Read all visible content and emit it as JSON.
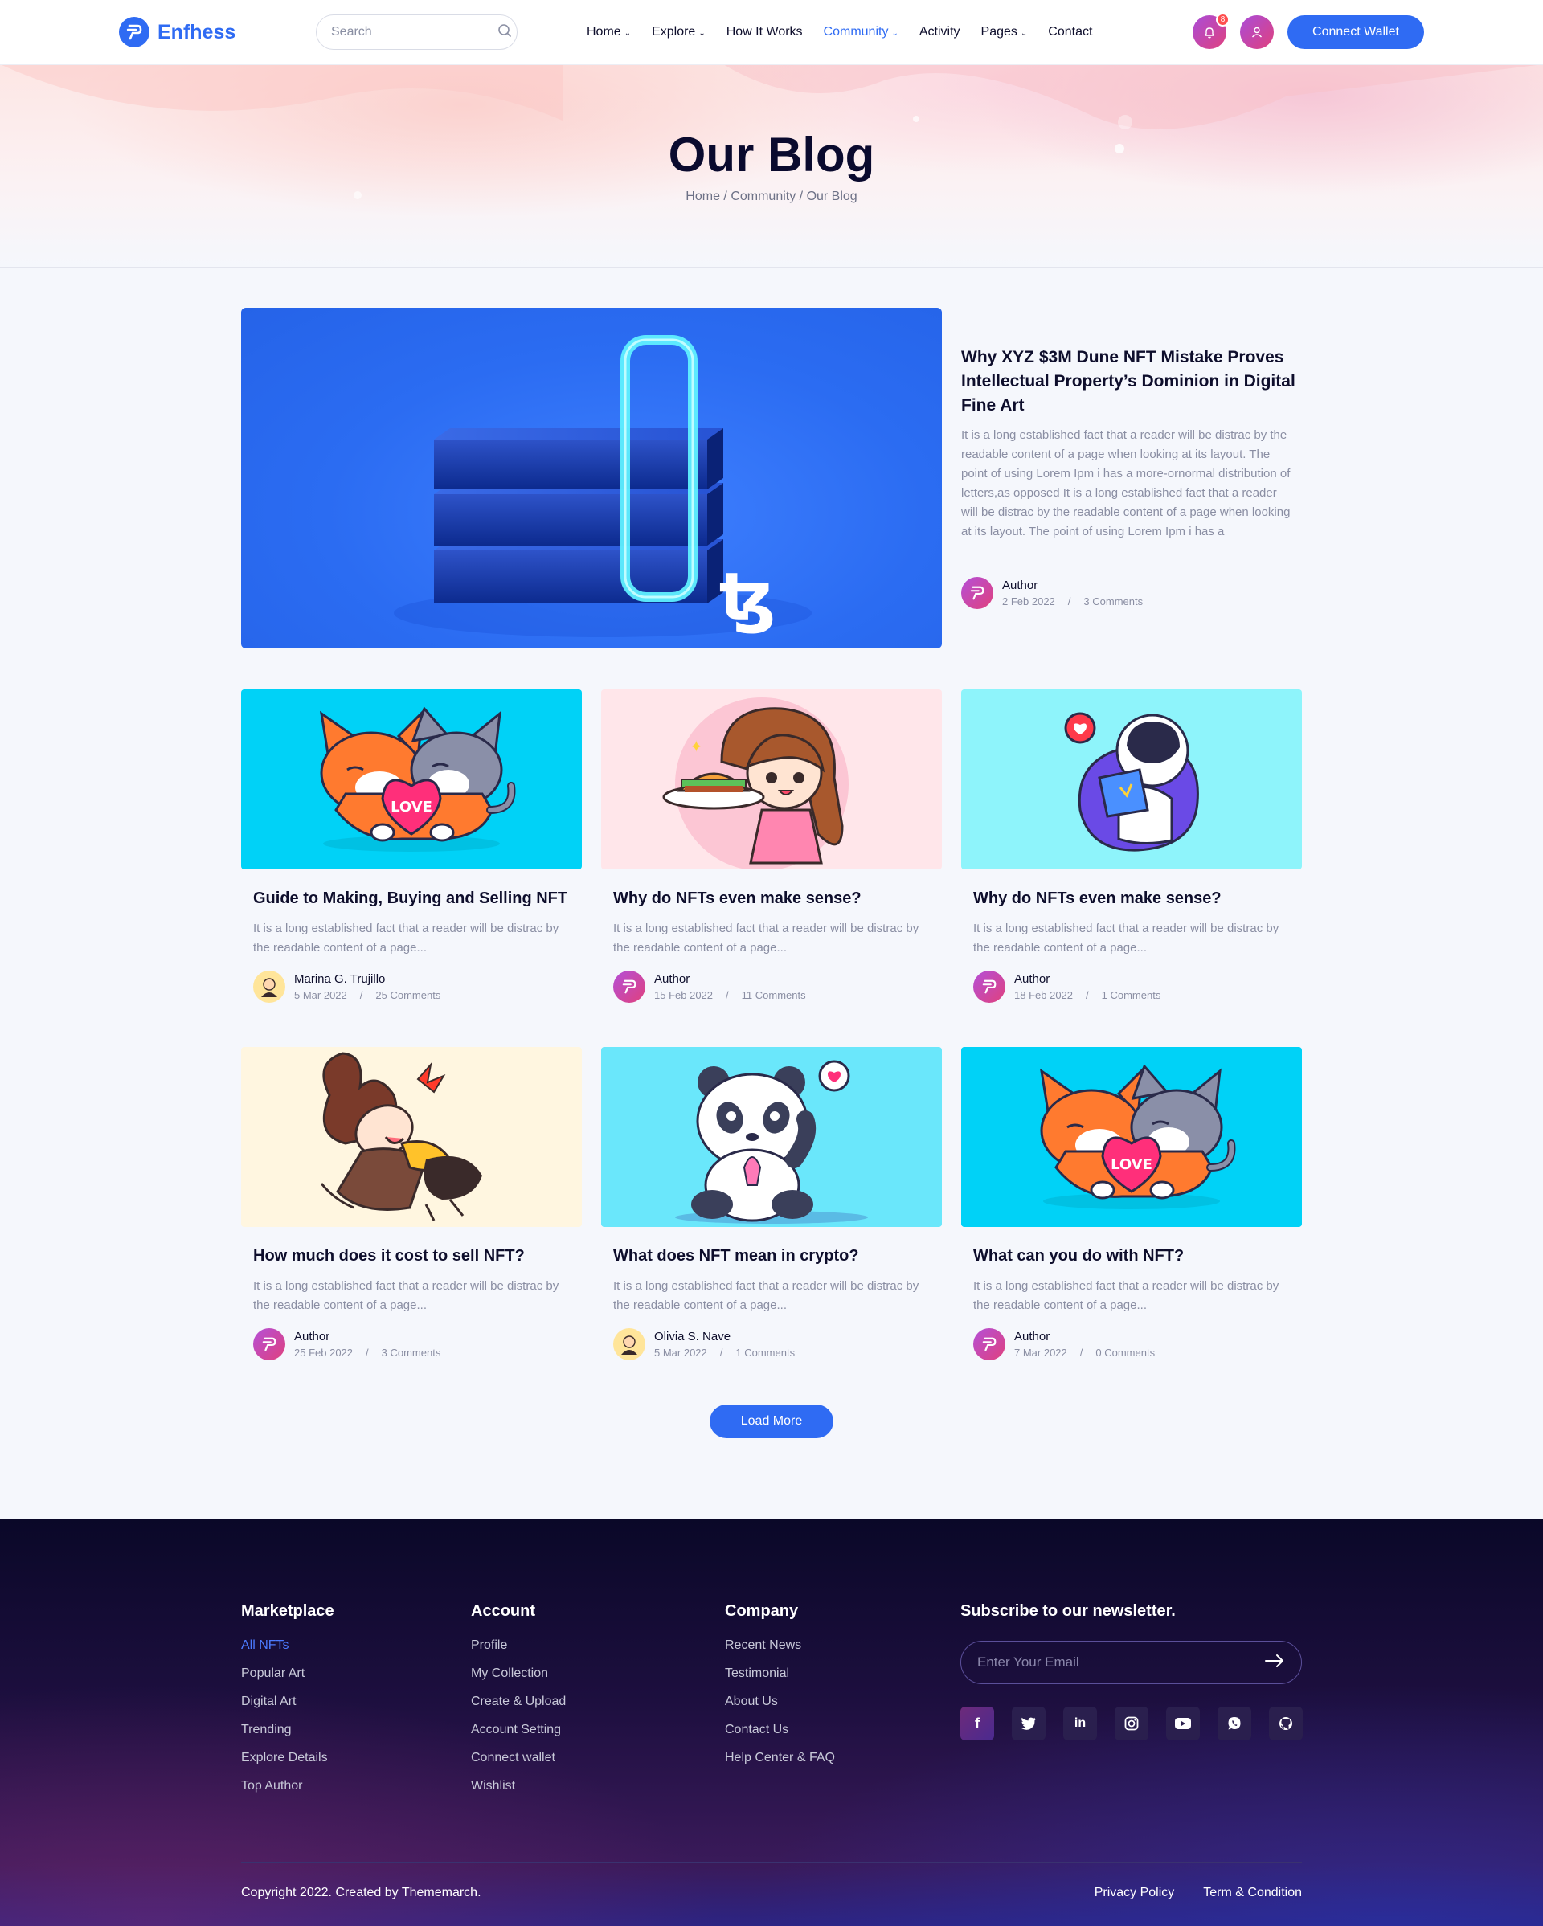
{
  "brand": {
    "name": "Enfhess",
    "primary": "#2f6bf3",
    "accent_gradient": [
      "#a94cd9",
      "#e0417d"
    ]
  },
  "nav": {
    "search_placeholder": "Search",
    "menu": [
      {
        "label": "Home",
        "dropdown": true
      },
      {
        "label": "Explore",
        "dropdown": true
      },
      {
        "label": "How It Works",
        "dropdown": false
      },
      {
        "label": "Community",
        "dropdown": true,
        "active": true
      },
      {
        "label": "Activity",
        "dropdown": false
      },
      {
        "label": "Pages",
        "dropdown": true
      },
      {
        "label": "Contact",
        "dropdown": false
      }
    ],
    "notification_count": "8",
    "connect_label": "Connect Wallet"
  },
  "hero": {
    "title": "Our Blog",
    "breadcrumb": [
      "Home",
      "Community",
      "Our Blog"
    ]
  },
  "featured": {
    "title": "Why XYZ $3M Dune NFT Mistake Proves Intellectual Property’s Dominion in Digital Fine Art",
    "excerpt": "It is a long established fact that a reader will be distrac by the readable content of a page when looking at its layout. The point of using Lorem Ipm i has a more-ornormal distribution of letters,as opposed It is a long established fact that a reader will be distrac by the readable content of a page when looking at its layout. The point of using Lorem Ipm i has a",
    "author": "Author",
    "date": "2 Feb 2022",
    "comments": "3 Comments"
  },
  "posts": [
    {
      "title": "Guide to Making, Buying and Selling NFT",
      "excerpt": "It is a long established fact that a reader will be distrac by the readable content of a page...",
      "author": "Marina G. Trujillo",
      "date": "5 Mar 2022",
      "comments": "25 Comments",
      "bg": "#00d2f7",
      "art": "cats"
    },
    {
      "title": "Why do NFTs even make sense?",
      "excerpt": "It is a long established fact that a reader will be distrac by the readable content of a page...",
      "author": "Author",
      "date": "15 Feb 2022",
      "comments": "11 Comments",
      "bg": "#ffe6ea",
      "art": "girl"
    },
    {
      "title": "Why do NFTs even make sense?",
      "excerpt": "It is a long established fact that a reader will be distrac by the readable content of a page...",
      "author": "Author",
      "date": "18 Feb 2022",
      "comments": "1 Comments",
      "bg": "#8ef4fb",
      "art": "astronaut"
    },
    {
      "title": "How much does it cost to sell NFT?",
      "excerpt": "It is a long established fact that a reader will be distrac by the readable content of a page...",
      "author": "Author",
      "date": "25 Feb 2022",
      "comments": "3 Comments",
      "bg": "#fff6e0",
      "art": "woman"
    },
    {
      "title": "What does NFT mean in crypto?",
      "excerpt": "It is a long established fact that a reader will be distrac by the readable content of a page...",
      "author": "Olivia S. Nave",
      "date": "5 Mar 2022",
      "comments": "1 Comments",
      "bg": "#6ae7fb",
      "art": "panda"
    },
    {
      "title": "What can you do with NFT?",
      "excerpt": "It is a long established fact that a reader will be distrac by the readable content of a page...",
      "author": "Author",
      "date": "7 Mar 2022",
      "comments": "0 Comments",
      "bg": "#00d2f7",
      "art": "cats"
    }
  ],
  "load_more": "Load More",
  "footer": {
    "marketplace": {
      "heading": "Marketplace",
      "links": [
        "All NFTs",
        "Popular Art",
        "Digital Art",
        "Trending",
        "Explore Details",
        "Top Author"
      ]
    },
    "account": {
      "heading": "Account",
      "links": [
        "Profile",
        "My Collection",
        "Create & Upload",
        "Account Setting",
        "Connect wallet",
        "Wishlist"
      ]
    },
    "company": {
      "heading": "Company",
      "links": [
        "Recent News",
        "Testimonial",
        "About Us",
        "Contact Us",
        "Help Center & FAQ"
      ]
    },
    "newsletter": {
      "heading": "Subscribe to our newsletter.",
      "placeholder": "Enter Your Email"
    },
    "social": [
      "facebook-icon",
      "twitter-icon",
      "linkedin-icon",
      "instagram-icon",
      "youtube-icon",
      "whatsapp-icon",
      "github-icon"
    ],
    "copyright": "Copyright 2022. Created by Thememarch.",
    "bottom_links": [
      "Privacy Policy",
      "Term & Condition"
    ]
  }
}
